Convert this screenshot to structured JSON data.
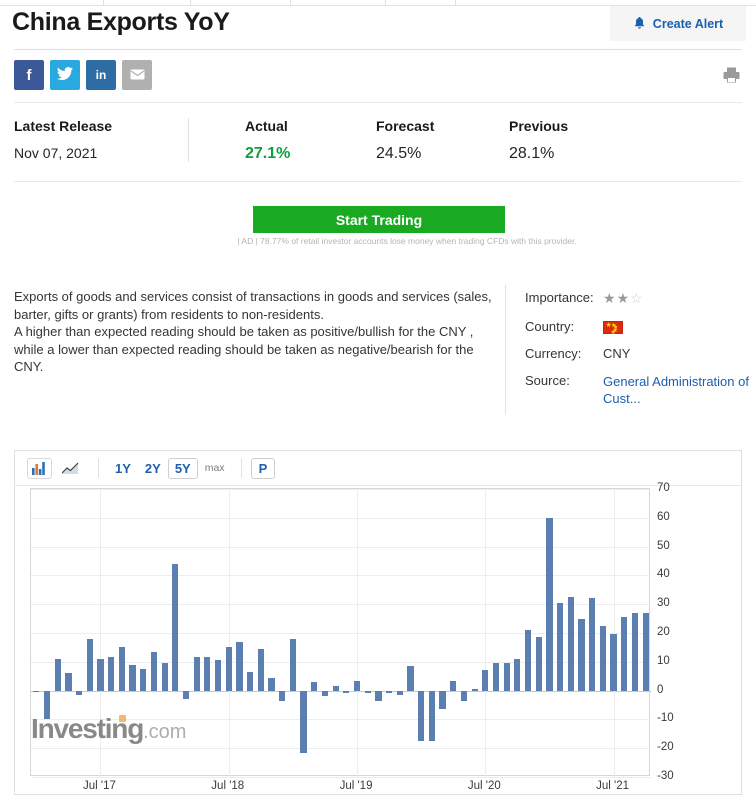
{
  "header": {
    "title": "China Exports YoY",
    "alert_label": "Create Alert",
    "alert_icon": "bell-icon",
    "print_icon": "printer-icon"
  },
  "social": [
    {
      "name": "facebook",
      "glyph": "f",
      "color": "#3b5998"
    },
    {
      "name": "twitter",
      "glyph": "ᵛ",
      "color": "#29a9e0"
    },
    {
      "name": "linkedin",
      "glyph": "in",
      "color": "#2d6da4"
    },
    {
      "name": "email",
      "glyph": "✉",
      "color": "#b0b0b0"
    }
  ],
  "stats": {
    "release_label": "Latest Release",
    "release_value": "Nov 07, 2021",
    "actual_label": "Actual",
    "actual_value": "27.1%",
    "forecast_label": "Forecast",
    "forecast_value": "24.5%",
    "previous_label": "Previous",
    "previous_value": "28.1%",
    "actual_color": "#0e9f3c"
  },
  "cta": {
    "button_label": "Start Trading",
    "disclaimer": "| AD | 78.77% of retail investor accounts lose money when trading CFDs with this provider.",
    "color": "#1aaa22"
  },
  "description": "Exports of goods and services consist of transactions in goods and services (sales, barter, gifts or grants) from residents to non-residents.\nA higher than expected reading should be taken as positive/bullish for the CNY , while a lower than expected reading should be taken as negative/bearish for the CNY.",
  "info": {
    "importance_label": "Importance:",
    "importance_filled": 2,
    "importance_total": 3,
    "country_label": "Country:",
    "country_flag": "china-flag-icon",
    "currency_label": "Currency:",
    "currency_value": "CNY",
    "source_label": "Source:",
    "source_value": "General Administration of Cust...",
    "link_color": "#1c5fad"
  },
  "chart_toolbar": {
    "bar_chart_icon": "bar-chart-icon",
    "line_chart_icon": "line-chart-icon",
    "chart_type_selected": "bar",
    "ranges": [
      "1Y",
      "2Y",
      "5Y",
      "max"
    ],
    "range_selected": "5Y",
    "p_button": "P"
  },
  "watermark": {
    "brand": "Investing",
    "suffix": ".com"
  },
  "chart_data": {
    "type": "bar",
    "title": "China Exports YoY",
    "xlabel": "",
    "ylabel": "",
    "ylim": [
      -30,
      70
    ],
    "yticks": [
      70,
      60,
      50,
      40,
      30,
      20,
      10,
      0,
      -10,
      -20,
      -30
    ],
    "xtick_labels": [
      "Jul '17",
      "Jul '18",
      "Jul '19",
      "Jul '20",
      "Jul '21"
    ],
    "xtick_index": [
      6,
      18,
      30,
      42,
      54
    ],
    "grid": true,
    "bar_color": "#5b7fb0",
    "unit": "%",
    "x": [
      "Jan '17",
      "Feb '17",
      "Mar '17",
      "Apr '17",
      "May '17",
      "Jun '17",
      "Jul '17",
      "Aug '17",
      "Sep '17",
      "Oct '17",
      "Nov '17",
      "Dec '17",
      "Jan '18",
      "Feb '18",
      "Mar '18",
      "Apr '18",
      "May '18",
      "Jun '18",
      "Jul '18",
      "Aug '18",
      "Sep '18",
      "Oct '18",
      "Nov '18",
      "Dec '18",
      "Jan '19",
      "Feb '19",
      "Mar '19",
      "Apr '19",
      "May '19",
      "Jun '19",
      "Jul '19",
      "Aug '19",
      "Sep '19",
      "Oct '19",
      "Nov '19",
      "Dec '19",
      "Jan '20",
      "Feb '20",
      "Mar '20",
      "Apr '20",
      "May '20",
      "Jun '20",
      "Jul '20",
      "Aug '20",
      "Sep '20",
      "Oct '20",
      "Nov '20",
      "Dec '20",
      "Jan '21",
      "Feb '21",
      "Mar '21",
      "Apr '21",
      "May '21",
      "Jun '21",
      "Jul '21",
      "Aug '21",
      "Sep '21",
      "Oct '21"
    ],
    "values": [
      -0.6,
      -10.0,
      11.0,
      6.0,
      -1.5,
      18.0,
      11.0,
      11.5,
      15.0,
      9.0,
      7.5,
      13.5,
      9.5,
      44.0,
      -3.0,
      11.5,
      11.5,
      10.5,
      15.0,
      17.0,
      6.5,
      14.5,
      4.5,
      -3.5,
      18.0,
      -21.5,
      3.0,
      -2.0,
      1.5,
      -1.0,
      3.5,
      -1.0,
      -3.5,
      -1.0,
      -1.5,
      8.5,
      -17.5,
      -17.5,
      -6.5,
      3.5,
      -3.5,
      0.5,
      7.0,
      9.5,
      9.5,
      11.0,
      21.0,
      18.5,
      60.0,
      30.5,
      32.5,
      25.0,
      32.0,
      22.5,
      19.5,
      25.5,
      27.0,
      27.1
    ]
  }
}
